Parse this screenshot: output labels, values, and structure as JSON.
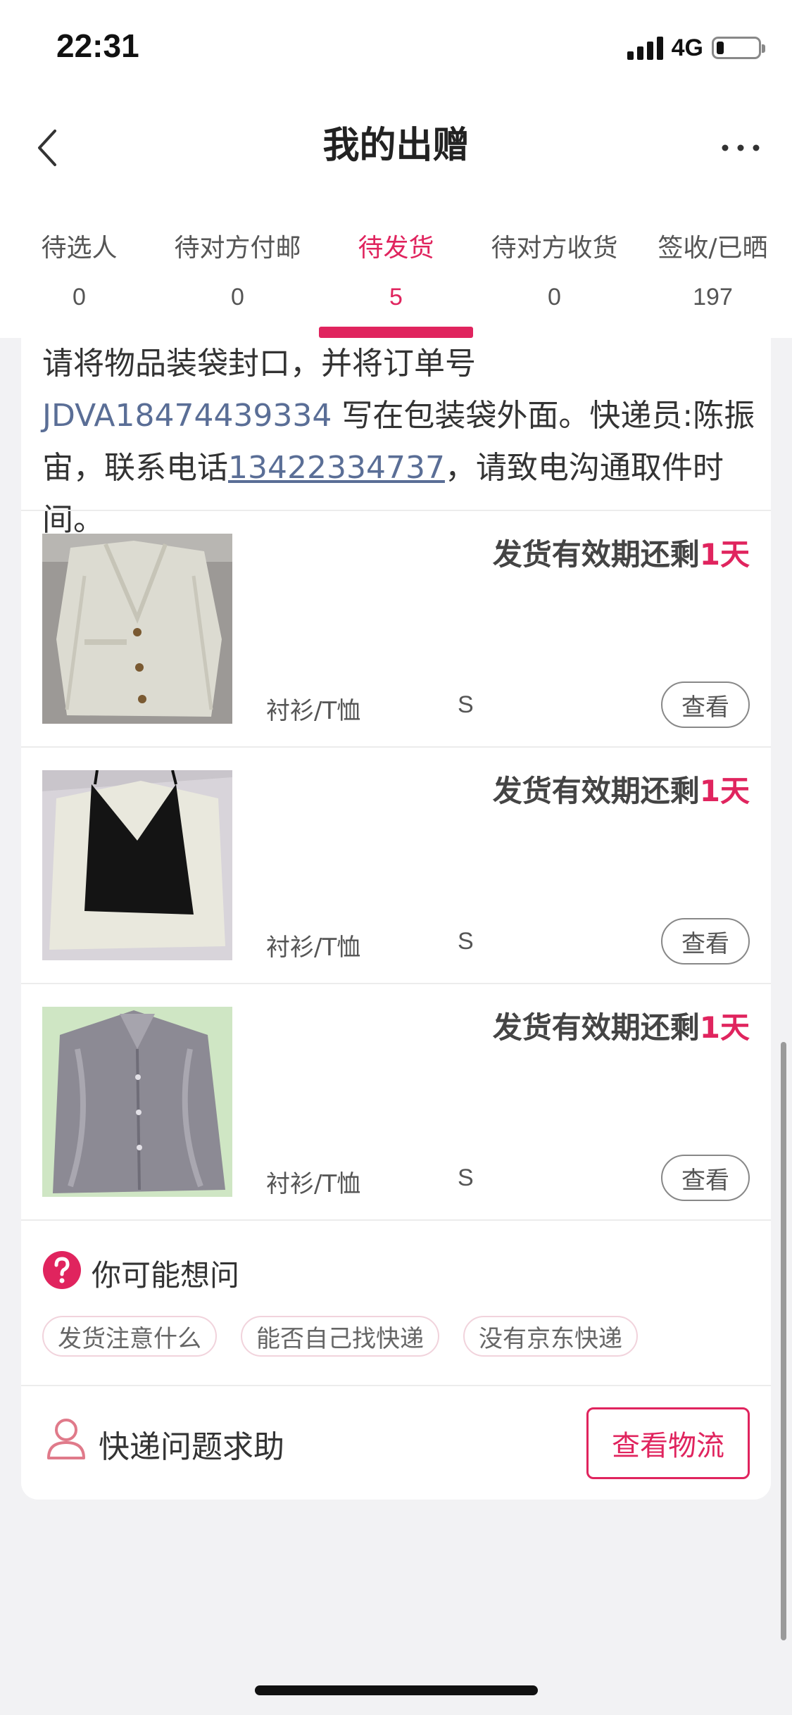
{
  "status_bar": {
    "time": "22:31",
    "network": "4G"
  },
  "nav": {
    "title": "我的出赠"
  },
  "tabs": [
    {
      "label": "待选人",
      "count": "0"
    },
    {
      "label": "待对方付邮",
      "count": "0"
    },
    {
      "label": "待发货",
      "count": "5",
      "active": true
    },
    {
      "label": "待对方收货",
      "count": "0"
    },
    {
      "label": "签收/已晒",
      "count": "197"
    }
  ],
  "notice": {
    "part1": "请将物品装袋封口，并将订单号 ",
    "order_number": "JDVA18474439334",
    "part2": " 写在包装袋外面。快递员:陈振宙，联系电话",
    "phone": "13422334737",
    "part3": "，请致电沟通取件时间。"
  },
  "items": [
    {
      "deadline_prefix": "发货有效期还剩",
      "deadline_days": "1天",
      "category": "衬衫/T恤",
      "size": "S",
      "view_label": "查看",
      "image": "cream-blazer"
    },
    {
      "deadline_prefix": "发货有效期还剩",
      "deadline_days": "1天",
      "category": "衬衫/T恤",
      "size": "S",
      "view_label": "查看",
      "image": "black-camisole-over-white-shirt"
    },
    {
      "deadline_prefix": "发货有效期还剩",
      "deadline_days": "1天",
      "category": "衬衫/T恤",
      "size": "S",
      "view_label": "查看",
      "image": "grey-satin-shirt"
    }
  ],
  "faq": {
    "title": "你可能想问",
    "chips": [
      "发货注意什么",
      "能否自己找快递",
      "没有京东快递"
    ]
  },
  "help": {
    "label": "快递问题求助",
    "button": "查看物流"
  },
  "colors": {
    "accent": "#e0245e",
    "link": "#5a6e96",
    "background": "#f2f2f4"
  }
}
